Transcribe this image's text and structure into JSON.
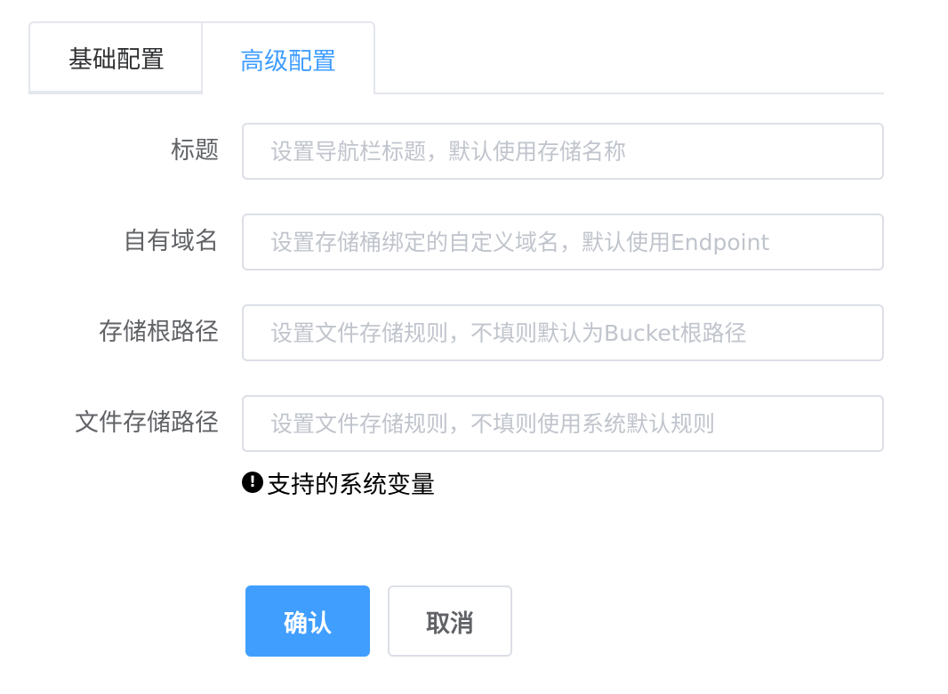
{
  "tabs": [
    {
      "label": "基础配置",
      "active": false
    },
    {
      "label": "高级配置",
      "active": true
    }
  ],
  "form": {
    "fields": [
      {
        "label": "标题",
        "value": "",
        "placeholder": "设置导航栏标题，默认使用存储名称"
      },
      {
        "label": "自有域名",
        "value": "",
        "placeholder": "设置存储桶绑定的自定义域名，默认使用Endpoint"
      },
      {
        "label": "存储根路径",
        "value": "",
        "placeholder": "设置文件存储规则，不填则默认为Bucket根路径"
      },
      {
        "label": "文件存储路径",
        "value": "",
        "placeholder": "设置文件存储规则，不填则使用系统默认规则"
      }
    ],
    "hint": {
      "icon": "exclamation-circle-icon",
      "glyph": "!",
      "text": "支持的系统变量"
    }
  },
  "actions": {
    "confirm_label": "确认",
    "cancel_label": "取消"
  },
  "colors": {
    "accent": "#409eff",
    "border": "#dcdfe6",
    "label": "#606266",
    "placeholder": "#c0c4cc"
  }
}
